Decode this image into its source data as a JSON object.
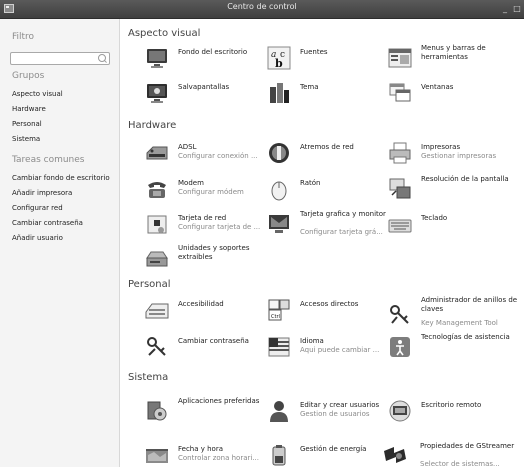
{
  "window": {
    "title": "Centro de control",
    "minimize": "_",
    "maximize": "□"
  },
  "sidebar": {
    "filter_heading": "Filtro",
    "search_placeholder": "",
    "groups_heading": "Grupos",
    "groups": [
      "Aspecto visual",
      "Hardware",
      "Personal",
      "Sistema"
    ],
    "tasks_heading": "Tareas comunes",
    "tasks": [
      "Cambiar fondo de escritorio",
      "Añadir impresora",
      "Configurar red",
      "Cambiar contraseña",
      "Añadir usuario"
    ]
  },
  "sections": {
    "aspecto": {
      "title": "Aspecto visual",
      "items": [
        {
          "line1": "Fondo del escritorio",
          "line2": "",
          "icon": "desktop-background-icon"
        },
        {
          "line1": "Fuentes",
          "line2": "",
          "icon": "fonts-icon"
        },
        {
          "line1": "Menus y barras de herramientas",
          "line2": "",
          "icon": "menus-toolbars-icon"
        },
        {
          "line1": "Salvapantallas",
          "line2": "",
          "icon": "screensaver-icon"
        },
        {
          "line1": "Tema",
          "line2": "",
          "icon": "theme-icon"
        },
        {
          "line1": "Ventanas",
          "line2": "",
          "icon": "windows-icon"
        }
      ]
    },
    "hardware": {
      "title": "Hardware",
      "items": [
        {
          "line1": "ADSL",
          "line2": "Configurar conexión ...",
          "icon": "adsl-modem-icon"
        },
        {
          "line1": "Atremos de red",
          "line2": "",
          "icon": "network-proxy-icon"
        },
        {
          "line1": "Impresoras",
          "line2": "Gestionar impresoras",
          "icon": "printer-icon"
        },
        {
          "line1": "Modem",
          "line2": "Configurar módem",
          "icon": "phone-modem-icon"
        },
        {
          "line1": "Ratón",
          "line2": "",
          "icon": "mouse-icon"
        },
        {
          "line1": "Resolución de la pantalla",
          "line2": "",
          "icon": "screen-resolution-icon"
        },
        {
          "line1": "Tarjeta de red",
          "line2": "Configurar tarjeta de ...",
          "icon": "network-card-icon"
        },
        {
          "line1": "Tarjeta grafica y monitor",
          "line2": "Configurar tarjeta grá...",
          "icon": "graphics-monitor-icon"
        },
        {
          "line1": "Teclado",
          "line2": "",
          "icon": "keyboard-icon"
        },
        {
          "line1": "Unidades y soportes extraibles",
          "line2": "",
          "icon": "removable-drive-icon"
        }
      ]
    },
    "personal": {
      "title": "Personal",
      "items": [
        {
          "line1": "Accesibilidad",
          "line2": "",
          "icon": "accessibility-keyboard-icon"
        },
        {
          "line1": "Accesos directos",
          "line2": "",
          "icon": "keyboard-shortcuts-icon"
        },
        {
          "line1": "Administrador de anillos de claves",
          "line2": "Key Management Tool",
          "icon": "keyring-icon"
        },
        {
          "line1": "Cambiar contraseña",
          "line2": "",
          "icon": "password-keys-icon"
        },
        {
          "line1": "Idioma",
          "line2": "Aqui puede cambiar ...",
          "icon": "language-flag-icon"
        },
        {
          "line1": "Tecnologías de asistencia",
          "line2": "",
          "icon": "assistive-tech-icon"
        }
      ]
    },
    "sistema": {
      "title": "Sistema",
      "items": [
        {
          "line1": "Aplicaciones preferidas",
          "line2": "",
          "icon": "preferred-apps-icon"
        },
        {
          "line1": "Editar y crear usuarios",
          "line2": "Gestion de usuarios",
          "icon": "users-icon"
        },
        {
          "line1": "Escritorio remoto",
          "line2": "",
          "icon": "remote-desktop-icon"
        },
        {
          "line1": "Fecha y hora",
          "line2": "Controlar zona horari...",
          "icon": "date-time-icon"
        },
        {
          "line1": "Gestión de energía",
          "line2": "",
          "icon": "power-battery-icon"
        },
        {
          "line1": "Propiedades de GStreamer",
          "line2": "Selector de sistemas...",
          "icon": "gstreamer-icon"
        }
      ]
    }
  }
}
